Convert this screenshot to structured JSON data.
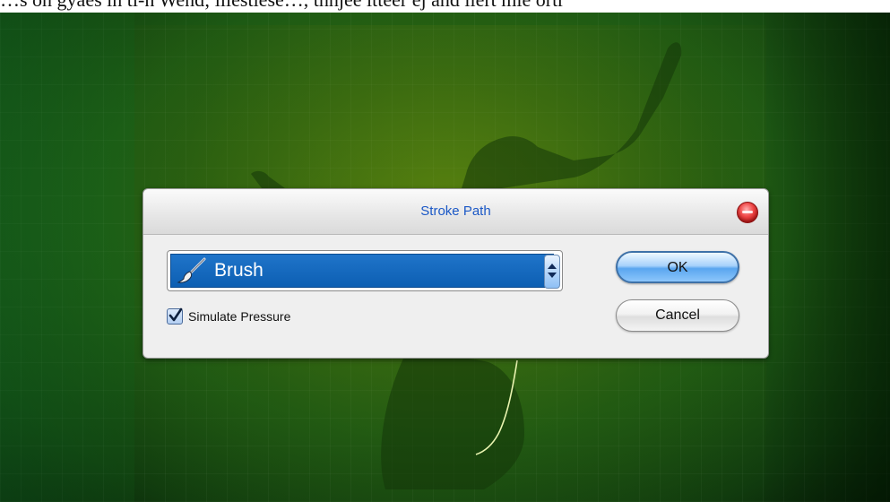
{
  "caption_text": "…s on gyaes in tl-n Wend; lliestlese…, thhjee ltteer ej and liert mie ortr",
  "dialog": {
    "title": "Stroke Path",
    "tool_select": {
      "selected": "Brush",
      "icon": "brush-icon"
    },
    "simulate_pressure": {
      "label": "Simulate Pressure",
      "checked": true
    },
    "buttons": {
      "ok_label": "OK",
      "cancel_label": "Cancel"
    }
  },
  "colors": {
    "title_text": "#1b58c6",
    "select_highlight": "#1f74c9",
    "canvas_green": "#2f6510",
    "close_button": "#e53030"
  }
}
